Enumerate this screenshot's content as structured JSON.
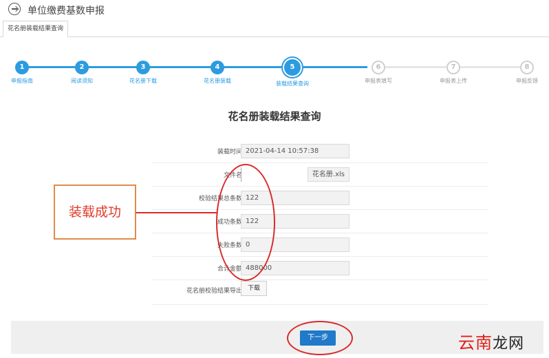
{
  "app": {
    "title": "单位缴费基数申报"
  },
  "tabs": [
    {
      "label": "花名册装载结果查询"
    }
  ],
  "steps": [
    {
      "num": "1",
      "label": "申报指南",
      "state": "done"
    },
    {
      "num": "2",
      "label": "阅读须知",
      "state": "done"
    },
    {
      "num": "3",
      "label": "花名册下载",
      "state": "done"
    },
    {
      "num": "4",
      "label": "花名册装载",
      "state": "done"
    },
    {
      "num": "5",
      "label": "装载结果查询",
      "state": "current"
    },
    {
      "num": "6",
      "label": "申报表填写",
      "state": "todo"
    },
    {
      "num": "7",
      "label": "申报表上传",
      "state": "todo"
    },
    {
      "num": "8",
      "label": "申报反馈",
      "state": "todo"
    }
  ],
  "form": {
    "title": "花名册装载结果查询",
    "load_time": {
      "label": "装载时间",
      "value": "2021-04-14 10:57:38"
    },
    "file_name": {
      "label": "文件名",
      "value": "花名册.xls"
    },
    "total_count": {
      "label": "校验结果总条数",
      "value": "122"
    },
    "success_count": {
      "label": "成功条数",
      "value": "122"
    },
    "fail_count": {
      "label": "失败条数",
      "value": "0"
    },
    "total_amount": {
      "label": "合计金额",
      "value": "488000"
    },
    "export": {
      "label": "花名册校验结果导出",
      "button": "下载"
    }
  },
  "annotation": {
    "callout_text": "装载成功",
    "color": "#d92a2a"
  },
  "footer": {
    "next_button": "下一步"
  },
  "watermark": {
    "part1": "云南",
    "part2": "龙网"
  },
  "colors": {
    "accent": "#2c9be0",
    "button": "#2079c9",
    "inactive": "#d0d0d0"
  }
}
